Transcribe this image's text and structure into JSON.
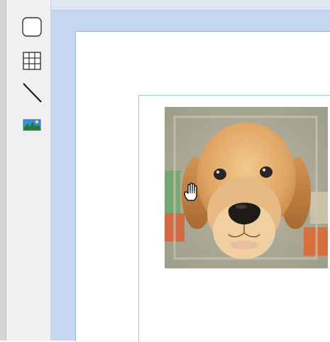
{
  "toolbar": {
    "tools": [
      {
        "name": "rectangle-tool",
        "icon": "rounded-square-icon"
      },
      {
        "name": "table-tool",
        "icon": "grid-icon"
      },
      {
        "name": "line-tool",
        "icon": "diagonal-line-icon"
      },
      {
        "name": "image-tool",
        "icon": "landscape-image-icon"
      }
    ]
  },
  "canvas": {
    "image": {
      "subject": "puppy-photo",
      "selected": true
    },
    "cursor": "hand-grab-cursor"
  },
  "colors": {
    "toolbar_bg": "#f0f0f0",
    "frame_bg": "#c5d7ee",
    "page_bg": "#ffffff",
    "content_border": "#8ed0e6"
  }
}
